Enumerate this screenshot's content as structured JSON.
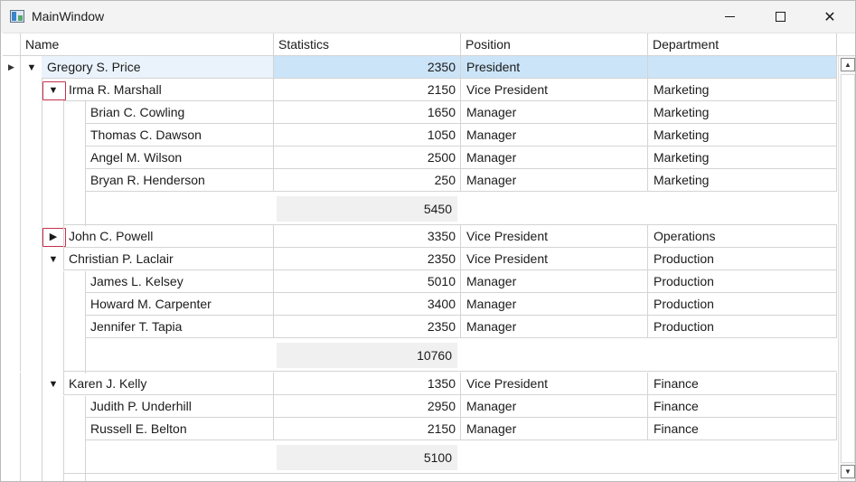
{
  "window": {
    "title": "MainWindow",
    "minimize_glyph": "",
    "maximize_glyph": "",
    "close_glyph": "✕"
  },
  "columns": [
    "Name",
    "Statistics",
    "Position",
    "Department"
  ],
  "rows": [
    {
      "name": "Gregory S. Price",
      "stats": "2350",
      "position": "President",
      "department": ""
    },
    {
      "name": "Irma R. Marshall",
      "stats": "2150",
      "position": "Vice President",
      "department": "Marketing"
    },
    {
      "name": "Brian C. Cowling",
      "stats": "1650",
      "position": "Manager",
      "department": "Marketing"
    },
    {
      "name": "Thomas C. Dawson",
      "stats": "1050",
      "position": "Manager",
      "department": "Marketing"
    },
    {
      "name": "Angel M. Wilson",
      "stats": "2500",
      "position": "Manager",
      "department": "Marketing"
    },
    {
      "name": "Bryan R. Henderson",
      "stats": "250",
      "position": "Manager",
      "department": "Marketing"
    },
    {
      "name": "John C. Powell",
      "stats": "3350",
      "position": "Vice President",
      "department": "Operations"
    },
    {
      "name": "Christian P. Laclair",
      "stats": "2350",
      "position": "Vice President",
      "department": "Production"
    },
    {
      "name": "James L. Kelsey",
      "stats": "5010",
      "position": "Manager",
      "department": "Production"
    },
    {
      "name": "Howard M. Carpenter",
      "stats": "3400",
      "position": "Manager",
      "department": "Production"
    },
    {
      "name": "Jennifer T. Tapia",
      "stats": "2350",
      "position": "Manager",
      "department": "Production"
    },
    {
      "name": "Karen J. Kelly",
      "stats": "1350",
      "position": "Vice President",
      "department": "Finance"
    },
    {
      "name": "Judith P. Underhill",
      "stats": "2950",
      "position": "Manager",
      "department": "Finance"
    },
    {
      "name": "Russell E. Belton",
      "stats": "2150",
      "position": "Manager",
      "department": "Finance"
    }
  ],
  "summaries": [
    "5450",
    "10760",
    "5100"
  ],
  "glyphs": {
    "expanded": "▼",
    "collapsed": "▶",
    "row_indicator": "▶",
    "scroll_up": "▲",
    "scroll_down": "▼"
  },
  "colors": {
    "selection": "#cce4f7",
    "expander_highlight": "#c4314b"
  }
}
